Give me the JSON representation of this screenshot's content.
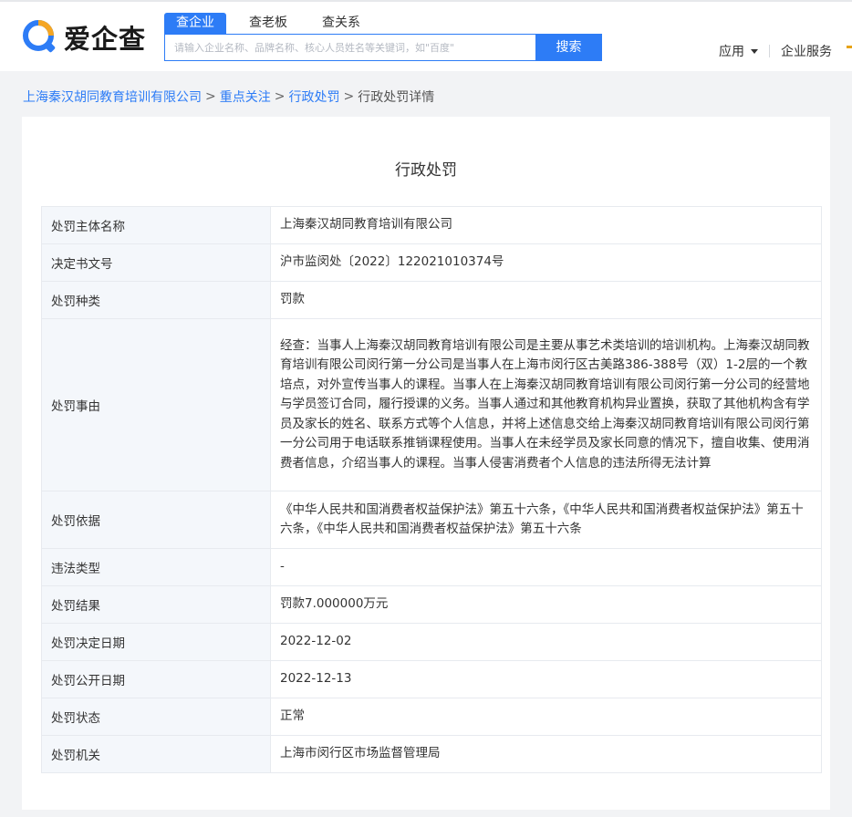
{
  "header": {
    "logo_text": "爱企查",
    "tabs": [
      {
        "label": "查企业",
        "active": true
      },
      {
        "label": "查老板",
        "active": false
      },
      {
        "label": "查关系",
        "active": false
      }
    ],
    "search": {
      "placeholder": "请输入企业名称、品牌名称、核心人员姓名等关键词，如\"百度\"",
      "button_label": "搜索"
    },
    "nav": {
      "apps_label": "应用",
      "enterprise_services_label": "企业服务"
    }
  },
  "breadcrumb": {
    "items": [
      "上海秦汉胡同教育培训有限公司",
      "重点关注",
      "行政处罚"
    ],
    "current": "行政处罚详情",
    "separator": ">"
  },
  "page": {
    "title": "行政处罚"
  },
  "detail": {
    "rows": [
      {
        "label": "处罚主体名称",
        "value": "上海秦汉胡同教育培训有限公司"
      },
      {
        "label": "决定书文号",
        "value": "沪市监闵处〔2022〕122021010374号"
      },
      {
        "label": "处罚种类",
        "value": "罚款"
      },
      {
        "label": "处罚事由",
        "value": "经查：当事人上海秦汉胡同教育培训有限公司是主要从事艺术类培训的培训机构。上海秦汉胡同教育培训有限公司闵行第一分公司是当事人在上海市闵行区古美路386-388号（双）1-2层的一个教培点，对外宣传当事人的课程。当事人在上海秦汉胡同教育培训有限公司闵行第一分公司的经营地与学员签订合同，履行授课的义务。当事人通过和其他教育机构异业置换，获取了其他机构含有学员及家长的姓名、联系方式等个人信息，并将上述信息交给上海秦汉胡同教育培训有限公司闵行第一分公司用于电话联系推销课程使用。当事人在未经学员及家长同意的情况下，擅自收集、使用消费者信息，介绍当事人的课程。当事人侵害消费者个人信息的违法所得无法计算"
      },
      {
        "label": "处罚依据",
        "value": "《中华人民共和国消费者权益保护法》第五十六条，《中华人民共和国消费者权益保护法》第五十六条，《中华人民共和国消费者权益保护法》第五十六条"
      },
      {
        "label": "违法类型",
        "value": "-"
      },
      {
        "label": "处罚结果",
        "value": "罚款7.000000万元"
      },
      {
        "label": "处罚决定日期",
        "value": "2022-12-02"
      },
      {
        "label": "处罚公开日期",
        "value": "2022-12-13"
      },
      {
        "label": "处罚状态",
        "value": "正常"
      },
      {
        "label": "处罚机关",
        "value": "上海市闵行区市场监督管理局"
      }
    ]
  },
  "colors": {
    "brand_blue": "#2d7cf6",
    "logo_orange": "#f5a623",
    "label_bg": "#f4f7fb"
  }
}
